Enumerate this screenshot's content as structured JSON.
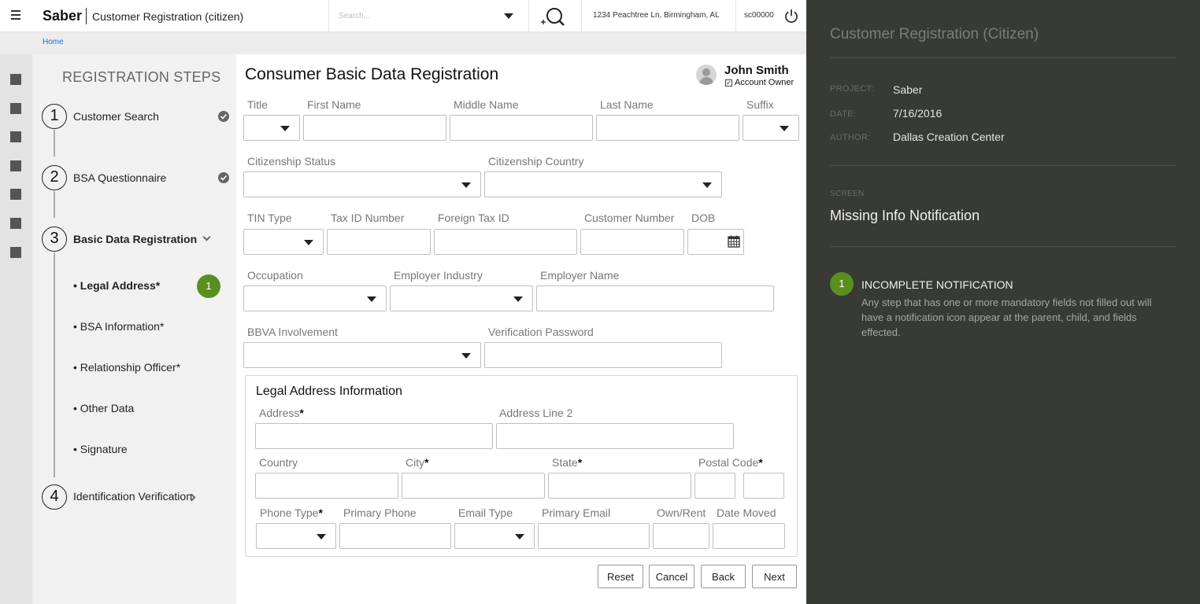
{
  "header": {
    "brand": "Saber",
    "app_title": "Customer Registration (citizen)",
    "search_placeholder": "Search...",
    "location": "1234 Peachtree Ln, Birmingham, AL",
    "user_code": "sc00000"
  },
  "breadcrumb": {
    "home": "Home"
  },
  "steps": {
    "title": "REGISTRATION STEPS",
    "items": [
      {
        "number": "1",
        "label": "Customer Search",
        "complete": true
      },
      {
        "number": "2",
        "label": "BSA Questionnaire",
        "complete": true
      },
      {
        "number": "3",
        "label": "Basic Data Registration",
        "expanded": true
      },
      {
        "number": "4",
        "label": "Identification Verification"
      }
    ],
    "sub_items": [
      {
        "label": "• Legal Address*",
        "badge": "1"
      },
      {
        "label": "• BSA Information*"
      },
      {
        "label": "• Relationship Officer*"
      },
      {
        "label": "• Other Data"
      },
      {
        "label": "• Signature"
      }
    ]
  },
  "form": {
    "title": "Consumer Basic Data Registration",
    "owner_name": "John Smith",
    "owner_role": "Account Owner",
    "labels": {
      "title": "Title",
      "first_name": "First Name",
      "middle_name": "Middle Name",
      "last_name": "Last Name",
      "suffix": "Suffix",
      "citizenship_status": "Citizenship Status",
      "citizenship_country": "Citizenship Country",
      "tin_type": "TIN Type",
      "tax_id": "Tax ID Number",
      "foreign_tax_id": "Foreign Tax ID",
      "customer_number": "Customer Number",
      "dob": "DOB",
      "occupation": "Occupation",
      "employer_industry": "Employer Industry",
      "employer_name": "Employer Name",
      "bbva_involvement": "BBVA Involvement",
      "verification_password": "Verification Password"
    },
    "legal_address": {
      "title": "Legal Address Information",
      "address": "Address",
      "address_line_2": "Address Line 2",
      "country": "Country",
      "city": "City",
      "state": "State",
      "postal_code": "Postal Code",
      "phone_type": "Phone Type",
      "primary_phone": "Primary Phone",
      "email_type": "Email Type",
      "primary_email": "Primary Email",
      "own_rent": "Own/Rent",
      "date_moved": "Date Moved",
      "required_mark": "*"
    },
    "buttons": {
      "reset": "Reset",
      "cancel": "Cancel",
      "back": "Back",
      "next": "Next"
    }
  },
  "annotation": {
    "title": "Customer Registration (Citizen)",
    "project_label": "PROJECT:",
    "project": "Saber",
    "date_label": "DATE:",
    "date": "7/16/2016",
    "author_label": "AUTHOR:",
    "author": "Dallas Creation Center",
    "screen_label": "SCREEN",
    "screen": "Missing Info Notification",
    "note_number": "1",
    "note_title": "INCOMPLETE NOTIFICATION",
    "note_body": "Any step that has one or more mandatory fields not filled out will have a notification icon appear at the parent, child, and fields effected."
  },
  "colors": {
    "accent_green": "#5a8f1f",
    "link_blue": "#1e6fd0",
    "panel_dark": "#383a35"
  }
}
